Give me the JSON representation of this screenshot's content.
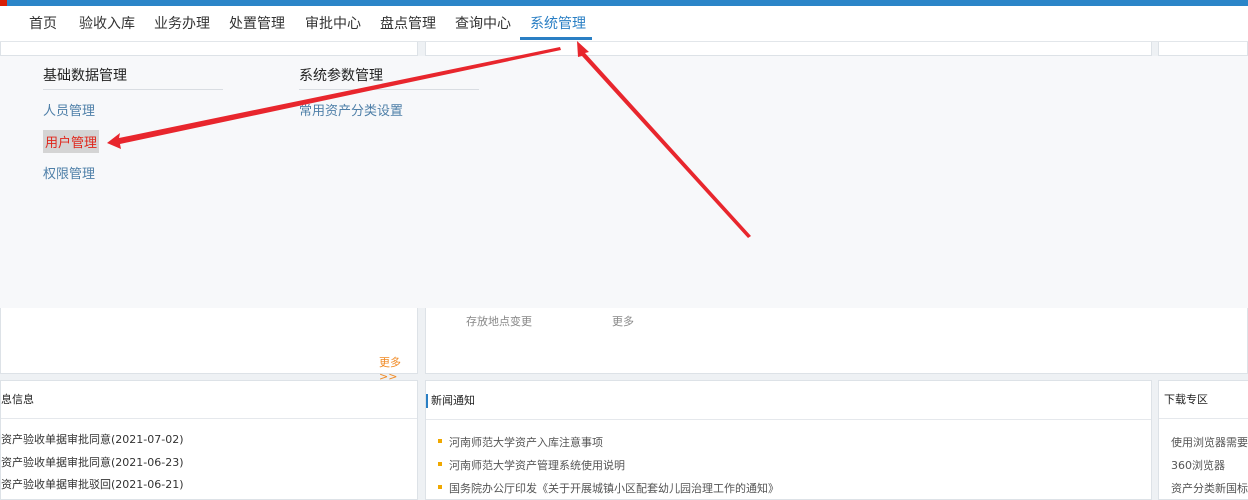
{
  "nav": {
    "items": [
      "首页",
      "验收入库",
      "业务办理",
      "处置管理",
      "审批中心",
      "盘点管理",
      "查询中心",
      "系统管理"
    ],
    "active_index": 7
  },
  "dropdown": {
    "columns": [
      {
        "title": "基础数据管理",
        "links": [
          "人员管理",
          "用户管理",
          "权限管理"
        ]
      },
      {
        "title": "系统参数管理",
        "links": [
          "常用资产分类设置"
        ]
      }
    ],
    "highlighted_link": "用户管理"
  },
  "middle": {
    "left_more": "更多>>",
    "right_item": "存放地点变更",
    "right_more": "更多"
  },
  "panels": {
    "left": {
      "title": "息信息",
      "items": [
        "资产验收单据审批同意(2021-07-02)",
        "资产验收单据审批同意(2021-06-23)",
        "资产验收单据审批驳回(2021-06-21)"
      ]
    },
    "news": {
      "title": "新闻通知",
      "items": [
        "河南师范大学资产入库注意事项",
        "河南师范大学资产管理系统使用说明",
        "国务院办公厅印发《关于开展城镇小区配套幼儿园治理工作的通知》"
      ]
    },
    "download": {
      "title": "下载专区",
      "items": [
        "使用浏览器需要设",
        "360浏览器",
        "资产分类新国标"
      ]
    }
  },
  "colors": {
    "accent": "#2a7fc4",
    "arrow": "#e8262d",
    "bullet": "#f0a800"
  }
}
